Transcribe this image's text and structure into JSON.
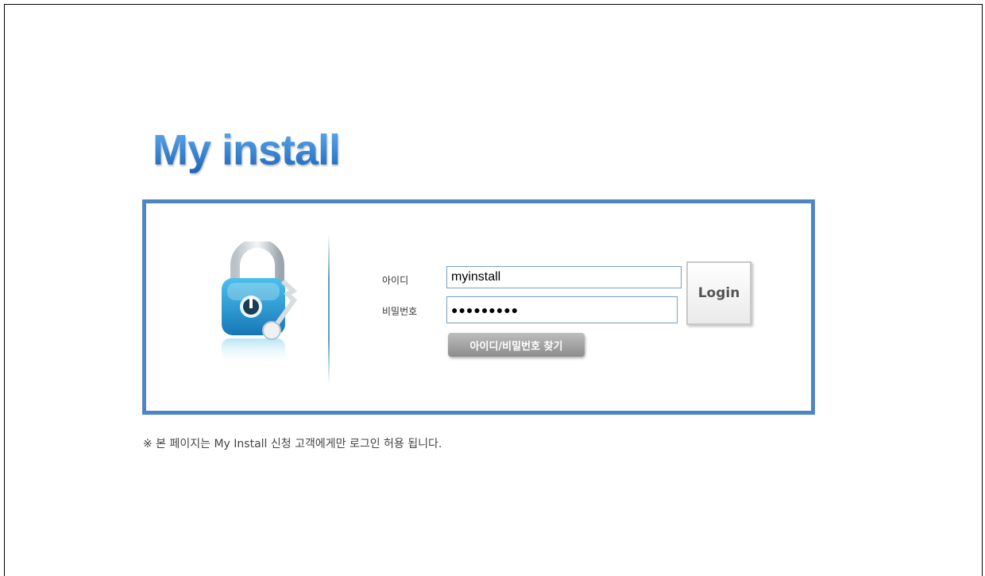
{
  "logo": {
    "text": "My install"
  },
  "login_form": {
    "id_label": "아이디",
    "id_value": "myinstall",
    "password_label": "비밀번호",
    "password_value": "●●●●●●●●●",
    "login_button": "Login",
    "find_button": "아이디/비밀번호 찾기"
  },
  "notice": "※ 본 페이지는 My Install 신청 고객에게만 로그인 허용 됩니다.",
  "colors": {
    "accent": "#4f86c2",
    "logo_blue": "#2f7fd0",
    "lock_teal": "#2a9fd6"
  },
  "icons": {
    "lock": "padlock-key-icon"
  }
}
